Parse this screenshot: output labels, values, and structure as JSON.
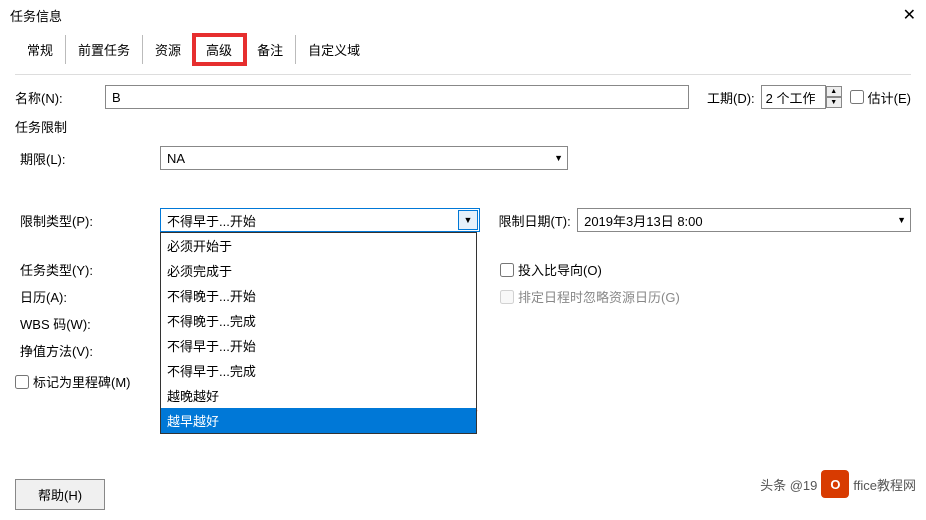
{
  "title": "任务信息",
  "tabs": [
    "常规",
    "前置任务",
    "资源",
    "高级",
    "备注",
    "自定义域"
  ],
  "active_tab_index": 3,
  "name_label": "名称(N):",
  "name_value": "B",
  "duration_label": "工期(D):",
  "duration_value": "2 个工作",
  "estimate_label": "估计(E)",
  "limit_section": "任务限制",
  "deadline_label": "期限(L):",
  "deadline_value": "NA",
  "limit_type_label": "限制类型(P):",
  "limit_type_selected": "不得早于...开始",
  "limit_type_options": [
    "必须开始于",
    "必须完成于",
    "不得晚于...开始",
    "不得晚于...完成",
    "不得早于...开始",
    "不得早于...完成",
    "越晚越好",
    "越早越好"
  ],
  "limit_type_highlight_index": 7,
  "limit_date_label": "限制日期(T):",
  "limit_date_value": "2019年3月13日 8:00",
  "task_type_label": "任务类型(Y):",
  "effort_driven_label": "投入比导向(O)",
  "calendar_label": "日历(A):",
  "ignore_calendar_label": "排定日程时忽略资源日历(G)",
  "wbs_label": "WBS 码(W):",
  "ev_method_label": "挣值方法(V):",
  "milestone_label": "标记为里程碑(M)",
  "help_btn": "帮助(H)",
  "watermark_left": "头条 @19",
  "watermark_right": "ffice教程网"
}
